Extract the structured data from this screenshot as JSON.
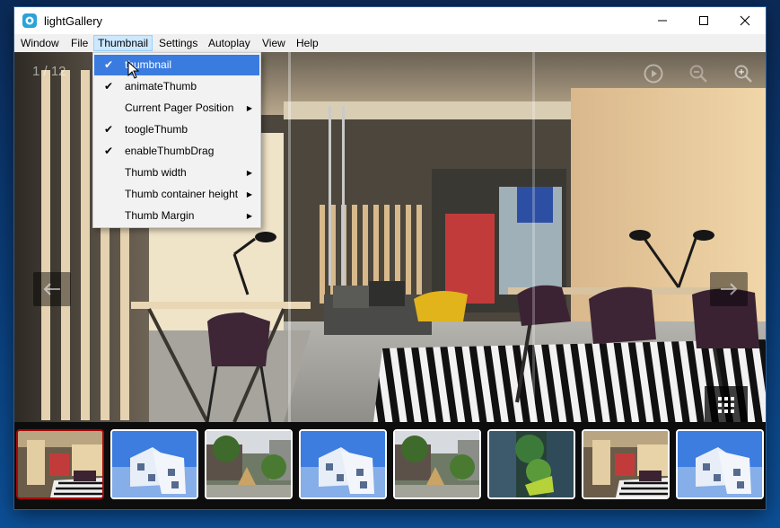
{
  "window": {
    "title": "lightGallery"
  },
  "menubar": [
    {
      "label": "Window",
      "active": false
    },
    {
      "label": "File",
      "active": false
    },
    {
      "label": "Thumbnail",
      "active": true
    },
    {
      "label": "Settings",
      "active": false
    },
    {
      "label": "Autoplay",
      "active": false
    },
    {
      "label": "View",
      "active": false
    },
    {
      "label": "Help",
      "active": false
    }
  ],
  "dropdown": {
    "items": [
      {
        "label": "thumbnail",
        "checked": true,
        "submenu": false,
        "highlighted": true
      },
      {
        "label": "animateThumb",
        "checked": true,
        "submenu": false,
        "highlighted": false
      },
      {
        "label": "Current Pager Position",
        "checked": false,
        "submenu": true,
        "highlighted": false
      },
      {
        "label": "toogleThumb",
        "checked": true,
        "submenu": false,
        "highlighted": false
      },
      {
        "label": "enableThumbDrag",
        "checked": true,
        "submenu": false,
        "highlighted": false
      },
      {
        "label": "Thumb width",
        "checked": false,
        "submenu": true,
        "highlighted": false
      },
      {
        "label": "Thumb container height",
        "checked": false,
        "submenu": true,
        "highlighted": false
      },
      {
        "label": "Thumb Margin",
        "checked": false,
        "submenu": true,
        "highlighted": false
      }
    ]
  },
  "gallery": {
    "counter": "1 / 12",
    "thumbnails": [
      {
        "scene": "office",
        "active": true
      },
      {
        "scene": "building",
        "active": false
      },
      {
        "scene": "garden",
        "active": false
      },
      {
        "scene": "building",
        "active": false
      },
      {
        "scene": "garden",
        "active": false
      },
      {
        "scene": "aerial",
        "active": false
      },
      {
        "scene": "office",
        "active": false
      },
      {
        "scene": "building",
        "active": false
      }
    ]
  },
  "icons": {
    "app": "lightgallery-app-icon",
    "minimize": "minimize-icon",
    "maximize": "maximize-icon",
    "close": "close-icon",
    "autoplay": "play-circle-icon",
    "zoom_out": "zoom-out-icon",
    "zoom_in": "zoom-in-icon",
    "prev": "arrow-left-icon",
    "next": "arrow-right-icon",
    "grid": "thumbnail-grid-icon",
    "check": "check-icon",
    "submenu": "submenu-arrow-icon"
  },
  "colors": {
    "menu_highlight": "#3a7be0",
    "active_thumb_border": "#a90707",
    "menubar_active": "#cce8ff"
  }
}
